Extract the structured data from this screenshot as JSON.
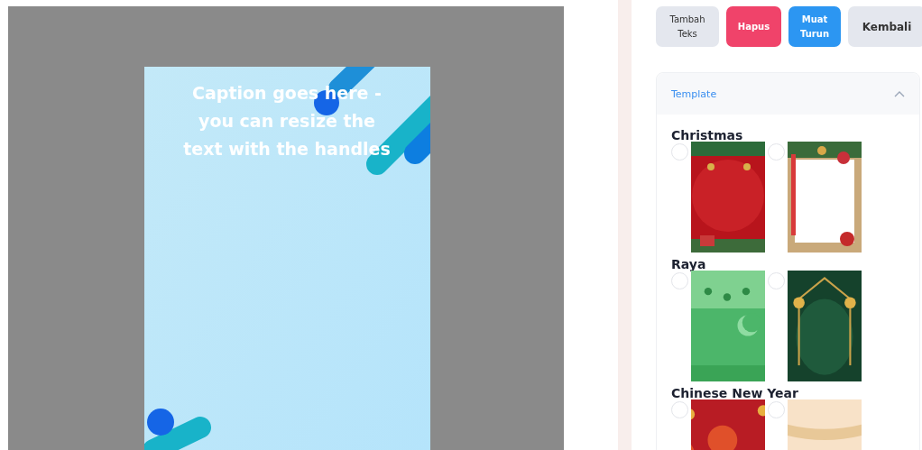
{
  "editor": {
    "caption": "Caption goes here - you can resize the text with the handles"
  },
  "toolbar": {
    "buttons": [
      {
        "label": "Tambah Teks",
        "kind": "neutral"
      },
      {
        "label": "Hapus",
        "kind": "danger"
      },
      {
        "label": "Muat Turun",
        "kind": "primary"
      },
      {
        "label": "Kembali",
        "kind": "neutral-large"
      }
    ]
  },
  "template_panel": {
    "title": "Template",
    "expanded": true,
    "groups": [
      {
        "name": "Christmas"
      },
      {
        "name": "Raya"
      },
      {
        "name": "Chinese New Year"
      }
    ]
  }
}
